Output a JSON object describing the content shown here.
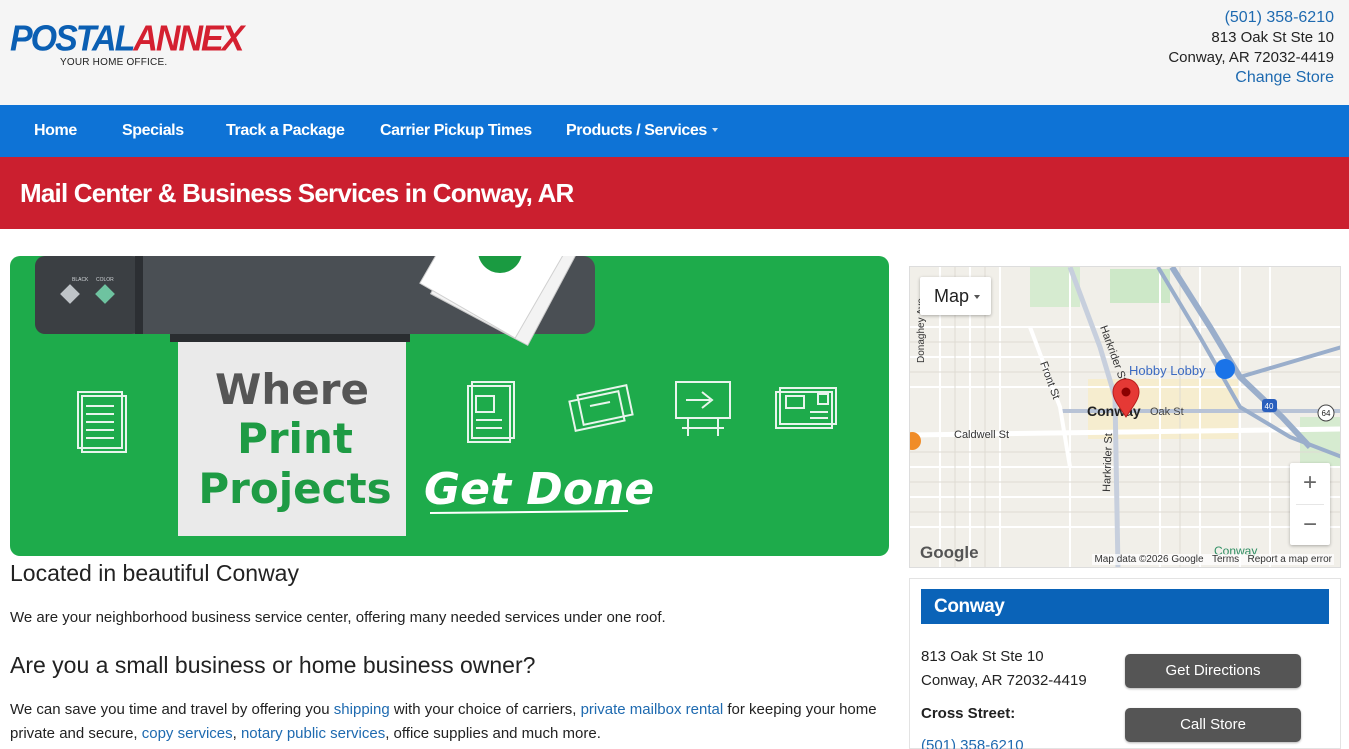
{
  "brand": {
    "logo_postal": "POSTAL",
    "logo_annex": "ANNEX",
    "tagline": "YOUR HOME OFFICE."
  },
  "contact": {
    "phone": "(501) 358-6210",
    "address_line1": "813 Oak St Ste 10",
    "address_line2": "Conway, AR 72032-4419",
    "change_store": "Change Store"
  },
  "nav": {
    "items": [
      {
        "label": "Home"
      },
      {
        "label": "Specials"
      },
      {
        "label": "Track a Package"
      },
      {
        "label": "Carrier Pickup Times"
      },
      {
        "label": "Products / Services"
      }
    ]
  },
  "page_title": "Mail Center & Business Services in Conway, AR",
  "hero": {
    "line1": "Where",
    "line2": "Print",
    "line3": "Projects",
    "script": "Get Done",
    "printer_btn1": "BLACK",
    "printer_btn2": "COLOR"
  },
  "content": {
    "heading1": "Located in beautiful Conway",
    "para1": "We are your neighborhood business service center, offering many needed services under one roof.",
    "heading2": "Are you a small business or home business owner?",
    "para2_part1": "We can save you time and travel by offering you ",
    "link_shipping": "shipping",
    "para2_part2": " with your choice of carriers, ",
    "link_mailbox": "private mailbox rental",
    "para2_part3": " for keeping your home",
    "para2_part4": "private and secure, ",
    "link_copy": "copy services",
    "para2_part5": ", ",
    "link_notary": "notary public services",
    "para2_part6": ", office supplies and much more."
  },
  "map": {
    "type_button": "Map",
    "labels": {
      "hobby_lobby": "Hobby Lobby",
      "conway": "Conway",
      "oak_st": "Oak St",
      "caldwell": "Caldwell St",
      "front_st": "Front St",
      "harkrider_upper": "Harkrider St",
      "harkrider_lower": "Harkrider St",
      "donaghey": "Donaghey Ave",
      "conway_bottom": "Conway",
      "interstate": "40",
      "highway": "64"
    },
    "zoom_in": "+",
    "zoom_out": "−",
    "google": "Google",
    "footer_data": "Map data ©2026 Google",
    "footer_terms": "Terms",
    "footer_report": "Report a map error"
  },
  "store_card": {
    "title": "Conway",
    "address_line1": "813 Oak St Ste 10",
    "address_line2": "Conway, AR 72032-4419",
    "cross_street_label": "Cross Street:",
    "phone": "(501) 358-6210",
    "directions_button": "Get Directions",
    "call_button": "Call Store"
  },
  "colors": {
    "nav_blue": "#0e73d6",
    "band_red": "#cb1f2f",
    "hero_green": "#1eab4b",
    "link_blue": "#1e6ab0"
  }
}
